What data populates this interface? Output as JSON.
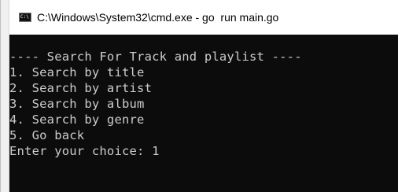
{
  "window": {
    "title": "C:\\Windows\\System32\\cmd.exe - go  run main.go",
    "icon": "cmd-icon",
    "icon_glyph": "C:\\"
  },
  "console": {
    "lines": [
      "---- Search For Track and playlist ----",
      "1. Search by title",
      "2. Search by artist",
      "3. Search by album",
      "4. Search by genre",
      "5. Go back",
      "Enter your choice: 1"
    ]
  },
  "colors": {
    "console_background": "#0c0c0c",
    "console_text": "#cccccc",
    "titlebar_background": "#ffffff"
  }
}
